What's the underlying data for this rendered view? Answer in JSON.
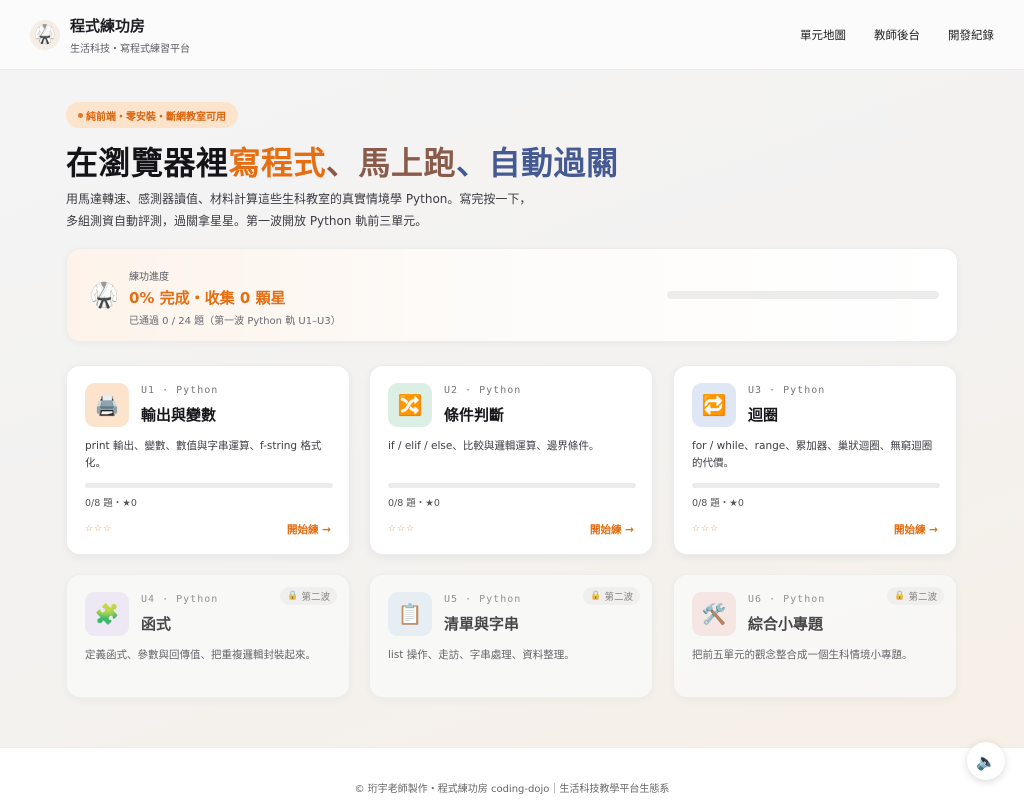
{
  "header": {
    "logo_icon": "karate-gi-icon",
    "title": "程式練功房",
    "subtitle": "生活科技・寫程式練習平台",
    "nav": [
      {
        "label": "單元地圖"
      },
      {
        "label": "教師後台"
      },
      {
        "label": "開發紀錄"
      }
    ]
  },
  "hero": {
    "badge": "純前端・零安裝・斷網教室可用",
    "title_main": "在瀏覽器裡",
    "title_part1": "寫程式",
    "title_sep1": "、",
    "title_part2": "馬上跑",
    "title_sep2": "、",
    "title_part3": "自動過關",
    "desc_line1": "用馬達轉速、感測器讀值、材料計算這些生科教室的真實情境學 Python。寫完按一下，",
    "desc_line2": "多組測資自動評測，過關拿星星。第一波開放 Python 軌前三單元。"
  },
  "progress": {
    "label": "練功進度",
    "main": "0% 完成・收集 0 顆星",
    "sub": "已通過 0 / 24 題（第一波 Python 軌 U1–U3）",
    "percent": 0
  },
  "units": [
    {
      "code": "U1",
      "sep": "·",
      "track": "Python",
      "name": "輸出與變數",
      "icon": "🖨️",
      "icon_name": "printer-icon",
      "icon_bg": "#fbe3cc",
      "desc": "print 輸出、變數、數值與字串運算、f-string 格式化。",
      "count": "0/8 題・★0",
      "stars": "☆☆☆",
      "start": "開始練 →",
      "progress": 0
    },
    {
      "code": "U2",
      "sep": "·",
      "track": "Python",
      "name": "條件判斷",
      "icon": "🔀",
      "icon_name": "shuffle-icon",
      "icon_bg": "#dcefe4",
      "desc": "if / elif / else、比較與邏輯運算、邊界條件。",
      "count": "0/8 題・★0",
      "stars": "☆☆☆",
      "start": "開始練 →",
      "progress": 0
    },
    {
      "code": "U3",
      "sep": "·",
      "track": "Python",
      "name": "迴圈",
      "icon": "🔁",
      "icon_name": "repeat-icon",
      "icon_bg": "#dfe6f4",
      "desc": "for / while、range、累加器、巢狀迴圈、無窮迴圈的代價。",
      "count": "0/8 題・★0",
      "stars": "☆☆☆",
      "start": "開始練 →",
      "progress": 0
    },
    {
      "code": "U4",
      "sep": "·",
      "track": "Python",
      "name": "函式",
      "icon": "🧩",
      "icon_name": "puzzle-icon",
      "icon_bg": "#ece6f5",
      "desc": "定義函式、參數與回傳值、把重複邏輯封裝起來。",
      "lock": "第二波"
    },
    {
      "code": "U5",
      "sep": "·",
      "track": "Python",
      "name": "清單與字串",
      "icon": "📋",
      "icon_name": "clipboard-icon",
      "icon_bg": "#e3eef5",
      "desc": "list 操作、走訪、字串處理、資料整理。",
      "lock": "第二波"
    },
    {
      "code": "U6",
      "sep": "·",
      "track": "Python",
      "name": "綜合小專題",
      "icon": "🛠️",
      "icon_name": "tools-icon",
      "icon_bg": "#f6e3e3",
      "desc": "把前五單元的觀念整合成一個生科情境小專題。",
      "lock": "第二波"
    }
  ],
  "footer": {
    "text": "© 珩宇老師製作・程式練功房 coding-dojo｜生活科技教學平台生態系"
  },
  "fab": {
    "icon": "🔈",
    "icon_name": "speaker-icon"
  },
  "colors": {
    "accent": "#e56d12",
    "brown": "#8a5a4a",
    "slate_blue": "#455a92"
  }
}
